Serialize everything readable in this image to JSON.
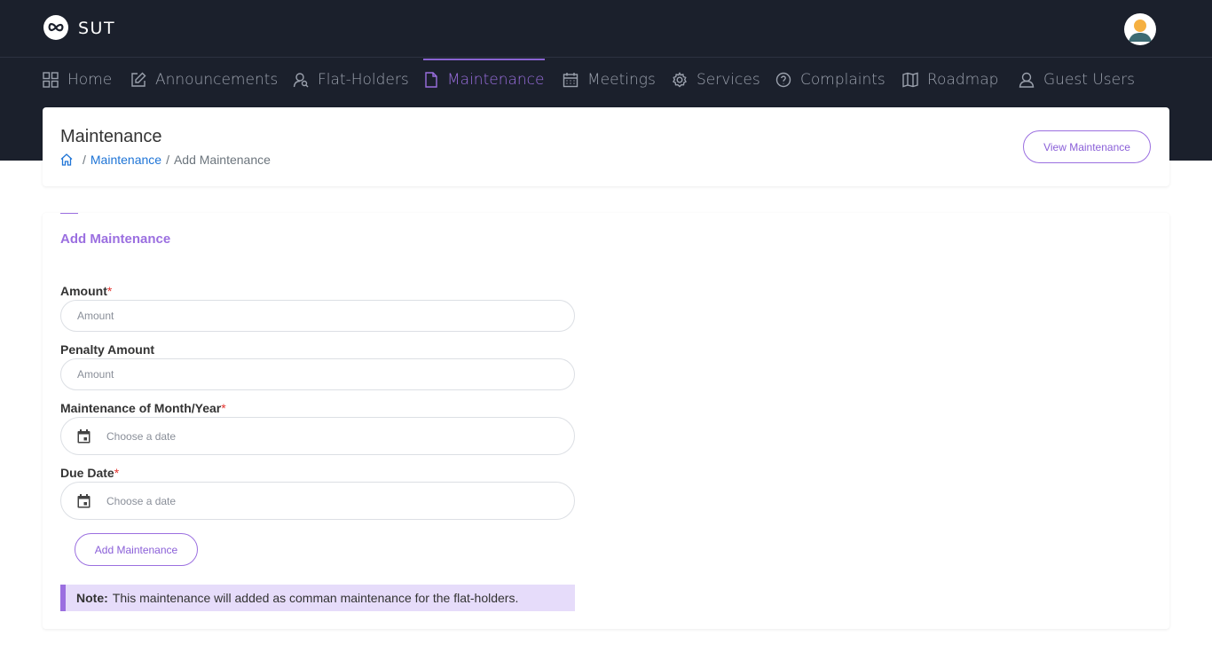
{
  "app": {
    "brand": "SUT"
  },
  "nav": {
    "items": [
      {
        "label": "Home",
        "icon": "grid-icon"
      },
      {
        "label": "Announcements",
        "icon": "edit-icon"
      },
      {
        "label": "Flat-Holders",
        "icon": "user-search-icon"
      },
      {
        "label": "Maintenance",
        "icon": "file-icon",
        "active": true
      },
      {
        "label": "Meetings",
        "icon": "calendar-icon"
      },
      {
        "label": "Services",
        "icon": "gear-icon"
      },
      {
        "label": "Complaints",
        "icon": "help-circle-icon"
      },
      {
        "label": "Roadmap",
        "icon": "map-icon"
      },
      {
        "label": "Guest Users",
        "icon": "user-icon"
      }
    ]
  },
  "header": {
    "title": "Maintenance",
    "breadcrumb": {
      "link": "Maintenance",
      "current": "Add Maintenance",
      "separator": "/"
    },
    "view_button": "View Maintenance"
  },
  "form": {
    "title": "Add Maintenance",
    "amount": {
      "label": "Amount",
      "required": "*",
      "placeholder": "Amount"
    },
    "penalty": {
      "label": "Penalty Amount",
      "placeholder": "Amount"
    },
    "month_year": {
      "label": "Maintenance of Month/Year",
      "required": "*",
      "placeholder": "Choose a date"
    },
    "due_date": {
      "label": "Due Date",
      "required": "*",
      "placeholder": "Choose a date"
    },
    "submit": "Add Maintenance",
    "note": {
      "prefix": "Note:",
      "text": "This maintenance will added as comman maintenance for the flat-holders."
    }
  },
  "colors": {
    "dark": "#1b202c",
    "accent": "#9b6fe0",
    "link": "#1e74d6",
    "note_bg": "#e6dcfa",
    "required": "#e3342f"
  }
}
